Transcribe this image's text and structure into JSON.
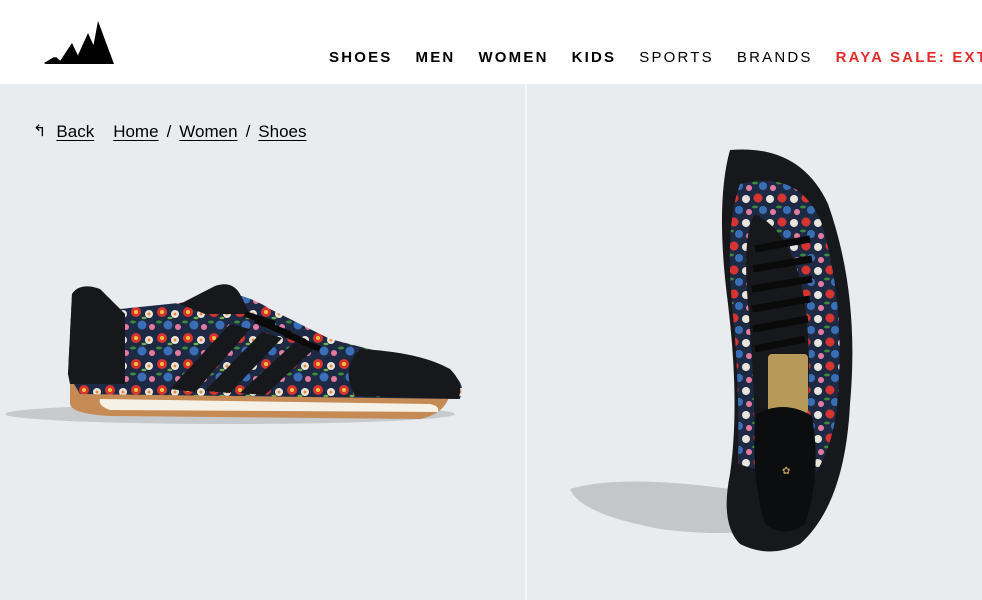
{
  "header": {
    "brand_logo": "adidas-three-bars-logo",
    "nav": [
      {
        "label": "SHOES",
        "style": "bold"
      },
      {
        "label": "MEN",
        "style": "bold"
      },
      {
        "label": "WOMEN",
        "style": "bold"
      },
      {
        "label": "KIDS",
        "style": "bold"
      },
      {
        "label": "SPORTS",
        "style": "light"
      },
      {
        "label": "BRANDS",
        "style": "light"
      },
      {
        "label": "RAYA SALE: EXTRA",
        "style": "sale"
      }
    ],
    "sale_color": "#e32b2b"
  },
  "breadcrumb": {
    "back_icon": "back-arrow-icon",
    "back_label": "Back",
    "items": [
      "Home",
      "Women",
      "Shoes"
    ],
    "separator": "/"
  },
  "gallery": {
    "background": "#e9ecee",
    "images": [
      {
        "name": "shoe-side-view"
      },
      {
        "name": "shoe-top-view"
      }
    ]
  }
}
